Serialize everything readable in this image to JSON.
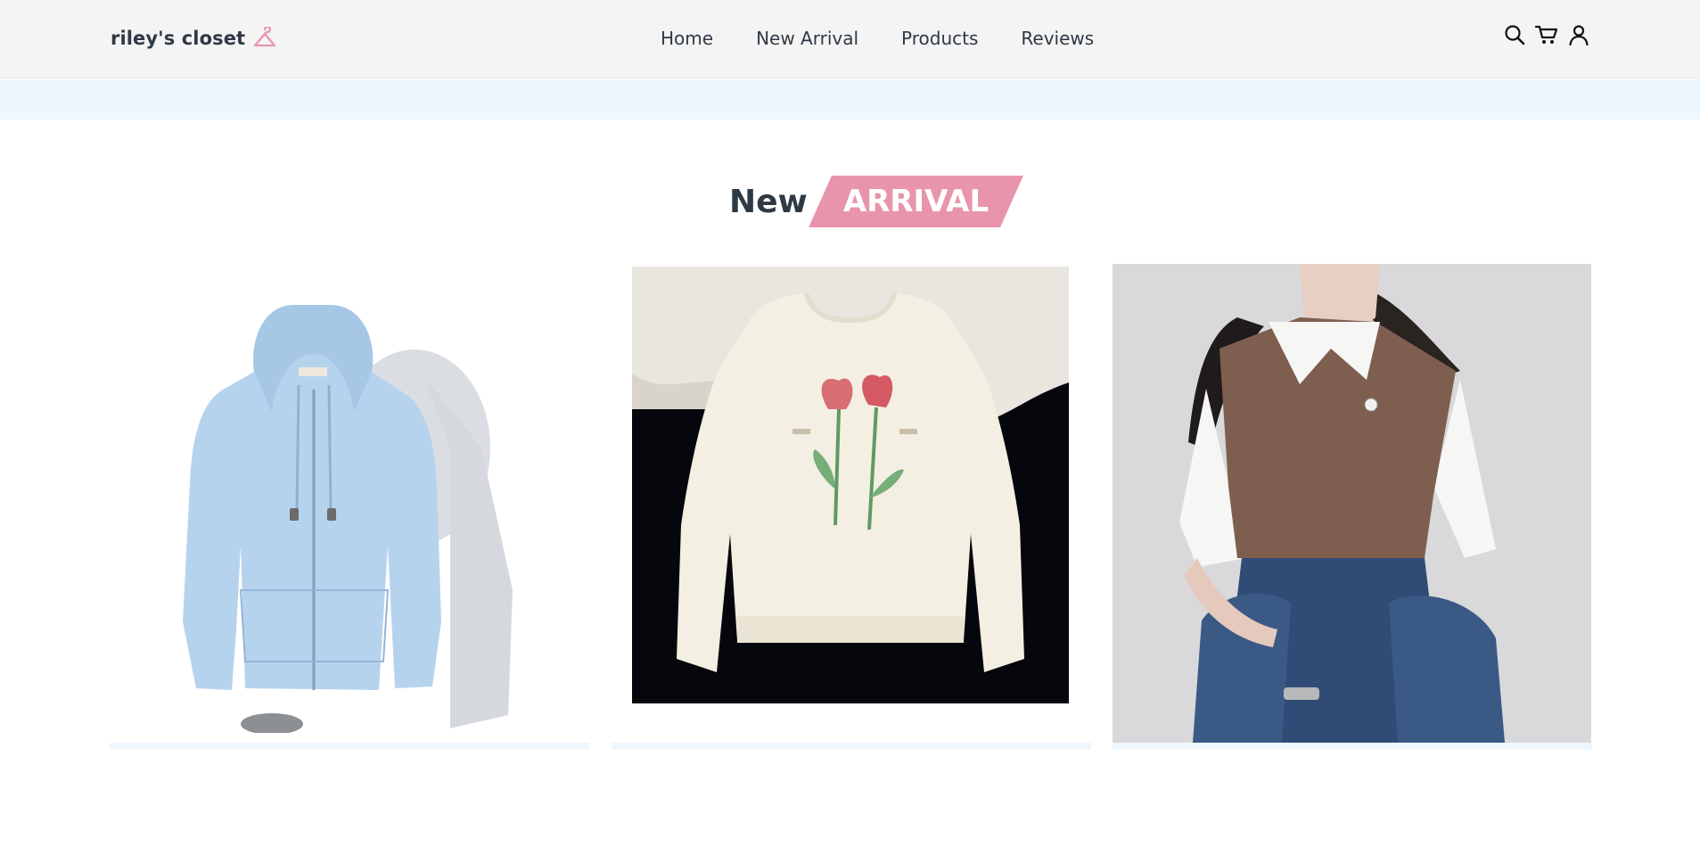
{
  "brand": {
    "name": "riley's closet",
    "icon": "hanger-icon",
    "accent": "#e895ab"
  },
  "nav": {
    "items": [
      {
        "label": "Home"
      },
      {
        "label": "New Arrival"
      },
      {
        "label": "Products"
      },
      {
        "label": "Reviews"
      }
    ]
  },
  "header_icons": [
    "search-icon",
    "cart-icon",
    "user-icon"
  ],
  "section": {
    "title_plain": "New",
    "title_highlight": "ARRIVAL"
  },
  "products": [
    {
      "image": "light-blue-zip-hoodie"
    },
    {
      "image": "cream-tulip-sweatshirt"
    },
    {
      "image": "brown-knit-vest-with-white-shirt"
    }
  ],
  "colors": {
    "header_bg": "#f4f4f4",
    "band_bg": "#eef6fe",
    "text": "#2f3944",
    "accent": "#e895ab"
  }
}
